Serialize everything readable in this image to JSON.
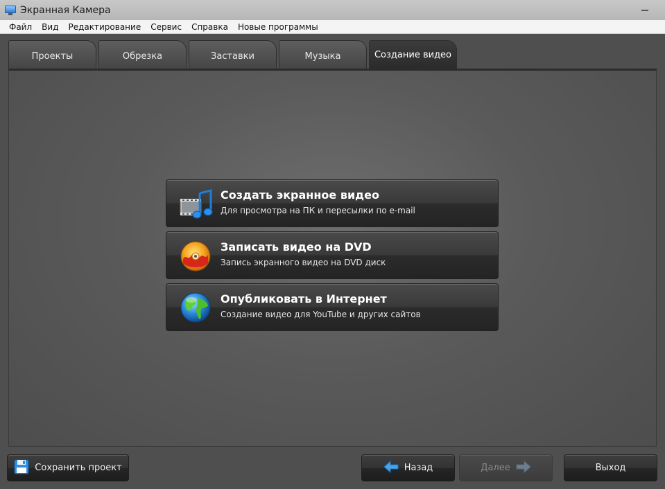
{
  "window": {
    "title": "Экранная Камера"
  },
  "menu": [
    "Файл",
    "Вид",
    "Редактирование",
    "Сервис",
    "Справка",
    "Новые программы"
  ],
  "tabs": [
    {
      "label": "Проекты",
      "active": false
    },
    {
      "label": "Обрезка",
      "active": false
    },
    {
      "label": "Заставки",
      "active": false
    },
    {
      "label": "Музыка",
      "active": false
    },
    {
      "label": "Создание видео",
      "active": true
    }
  ],
  "actions": [
    {
      "title": "Создать экранное видео",
      "desc": "Для просмотра на ПК и пересылки по e-mail",
      "icon": "film-music-icon"
    },
    {
      "title": "Записать видео на DVD",
      "desc": "Запись экранного видео на DVD диск",
      "icon": "dvd-disc-icon"
    },
    {
      "title": "Опубликовать в Интернет",
      "desc": "Создание видео для YouTube и других сайтов",
      "icon": "globe-icon"
    }
  ],
  "footer": {
    "save_label": "Сохранить проект",
    "back_label": "Назад",
    "next_label": "Далее",
    "exit_label": "Выход"
  },
  "colors": {
    "background": "#4f4f4f",
    "accent_arrow": "#4aa3e8"
  }
}
